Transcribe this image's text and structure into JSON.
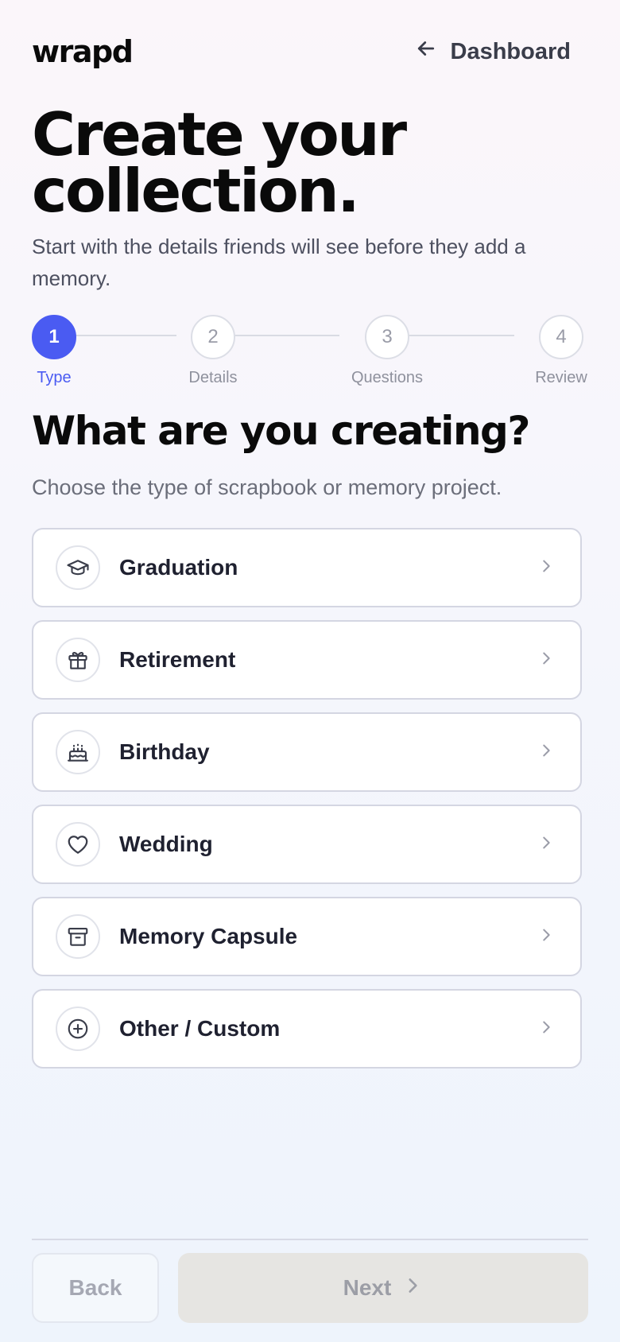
{
  "app": {
    "logo": "wrapd"
  },
  "nav": {
    "back_link_label": "Dashboard"
  },
  "header": {
    "title": "Create your collection.",
    "subtitle": "Start with the details friends will see before they add a memory."
  },
  "stepper": {
    "current_step": 1,
    "steps": [
      {
        "number": "1",
        "label": "Type"
      },
      {
        "number": "2",
        "label": "Details"
      },
      {
        "number": "3",
        "label": "Questions"
      },
      {
        "number": "4",
        "label": "Review"
      }
    ]
  },
  "section": {
    "title": "What are you creating?",
    "subtitle": "Choose the type of scrapbook or memory project."
  },
  "options": [
    {
      "label": "Graduation",
      "icon": "graduation-cap-icon"
    },
    {
      "label": "Retirement",
      "icon": "gift-icon"
    },
    {
      "label": "Birthday",
      "icon": "cake-icon"
    },
    {
      "label": "Wedding",
      "icon": "heart-icon"
    },
    {
      "label": "Memory Capsule",
      "icon": "archive-box-icon"
    },
    {
      "label": "Other / Custom",
      "icon": "plus-circle-icon"
    }
  ],
  "footer": {
    "back_label": "Back",
    "next_label": "Next"
  },
  "colors": {
    "accent": "#4a5bf2",
    "disabled_button": "#e6e5e2"
  }
}
